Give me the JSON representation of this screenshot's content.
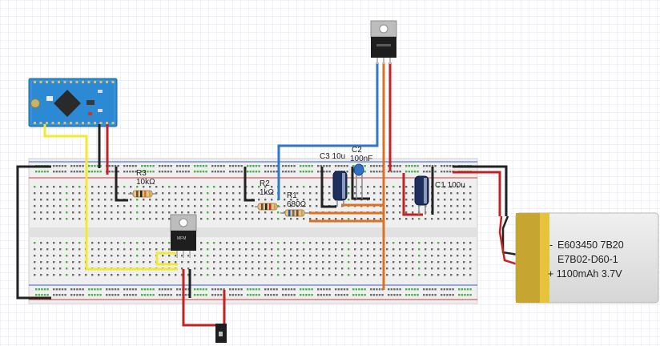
{
  "components": {
    "r3": {
      "name": "R3",
      "value": "10kΩ"
    },
    "r2": {
      "name": "R2",
      "value": "1kΩ"
    },
    "r1": {
      "name": "R1",
      "value": "680Ω"
    },
    "c3": {
      "label": "C3 10u"
    },
    "c2": {
      "name": "C2",
      "value": "100nF"
    },
    "c1": {
      "label": "C1 100u"
    }
  },
  "battery": {
    "line1": "E603450 7B20",
    "line2": "E7B02-D60-1",
    "line3": "+ 1100mAh 3.7V",
    "minus": "-"
  },
  "chip_labels": {
    "mosfet": "MFM"
  },
  "colors": {
    "grid": "#e3e6ef",
    "breadboard": "#efefef",
    "rail_red": "#d0393b",
    "rail_blue": "#3b5fcf",
    "hole_green": "#46b248",
    "hole_gray": "#6a6a6a",
    "wire_yellow": "#f2ea31",
    "wire_black": "#222222",
    "wire_red": "#c22222",
    "wire_blue": "#3079c9",
    "wire_orange": "#dd7022",
    "arduino_blue": "#2b8ad3",
    "battery_gold": "#c7a531",
    "battery_silver": "#dedede"
  }
}
